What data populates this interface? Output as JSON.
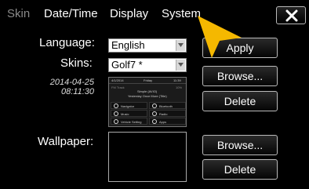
{
  "tabs": [
    {
      "label": "Skin",
      "active": false
    },
    {
      "label": "Date/Time",
      "active": true
    },
    {
      "label": "Display",
      "active": true
    },
    {
      "label": "System",
      "active": true
    }
  ],
  "close_label": "✕",
  "form": {
    "language_label": "Language:",
    "language_value": "English",
    "skins_label": "Skins:",
    "skins_value": "Golf7 *",
    "date": "2014-04-25",
    "time": "08:11:30",
    "wallpaper_label": "Wallpaper:"
  },
  "buttons": {
    "apply": "Apply",
    "browse_skin": "Browse...",
    "delete_skin": "Delete",
    "browse_wallpaper": "Browse...",
    "delete_wallpaper": "Delete"
  },
  "preview": {
    "date": "4/1/2014",
    "day": "Friday",
    "clock": "11:39",
    "fm": "FM Track",
    "percent": "10%",
    "line1": "Simple (AVIO)",
    "line2": "Yesterday Once More (Title)",
    "cells": [
      "Navigator",
      "Bluetooth",
      "Music",
      "Radio",
      "Vehicle Setting",
      "Apps"
    ]
  },
  "colors": {
    "background": "#000000",
    "pointer": "#F5B800"
  }
}
